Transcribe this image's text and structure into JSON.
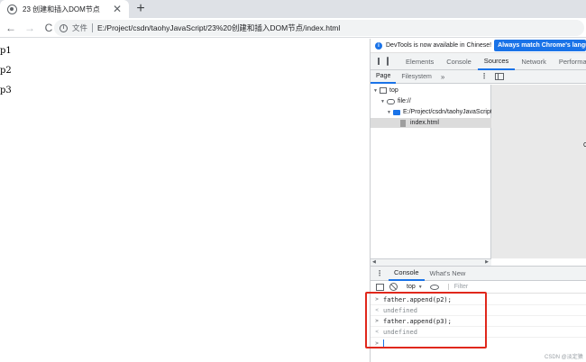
{
  "browser": {
    "tab": {
      "title": "23 创建和插入DOM节点",
      "close_glyph": "✕"
    },
    "new_tab_glyph": "+",
    "toolbar": {
      "back_glyph": "←",
      "forward_glyph": "→",
      "reload_glyph": "C",
      "info_glyph": "i",
      "scheme_label": "文件",
      "url": "E:/Project/csdn/taohyJavaScript/23%20创建和插入DOM节点/index.html"
    }
  },
  "page": {
    "paragraphs": [
      "p1",
      "p2",
      "p3"
    ]
  },
  "devtools": {
    "banner": {
      "text": "DevTools is now available in Chinese!",
      "button": "Always match Chrome's language"
    },
    "tabs": [
      "Elements",
      "Console",
      "Sources",
      "Network",
      "Performance"
    ],
    "active_tab": "Sources",
    "sources": {
      "subtabs": [
        "Page",
        "Filesystem"
      ],
      "more_glyph": "»",
      "tree": {
        "top": "top",
        "origin": "file://",
        "folder": "E:/Project/csdn/taohyJavaScript",
        "file": "index.html"
      },
      "editor_mark": "C"
    },
    "drawer": {
      "tabs": [
        "Console",
        "What's New"
      ],
      "context": "top",
      "filter_placeholder": "Filter"
    },
    "console": {
      "lines": [
        {
          "prefix": ">",
          "text": "father.append(p2);"
        },
        {
          "prefix": "<",
          "text": "undefined"
        },
        {
          "prefix": ">",
          "text": "father.append(p3);"
        },
        {
          "prefix": "<",
          "text": "undefined"
        },
        {
          "prefix": ">",
          "text": ""
        }
      ]
    }
  },
  "watermark": "CSDN @淡定猿",
  "colors": {
    "accent": "#1a73e8",
    "highlight_box": "#e0281c"
  }
}
